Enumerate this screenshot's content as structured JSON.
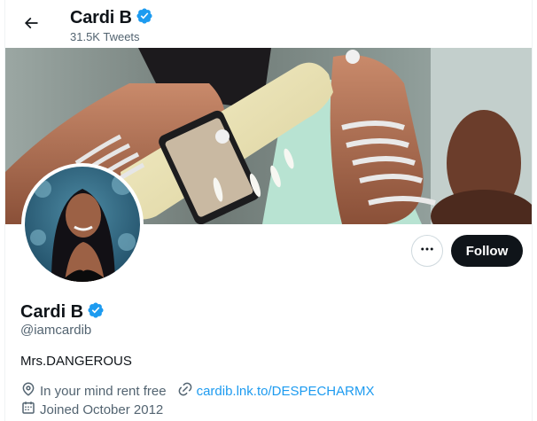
{
  "header": {
    "name": "Cardi B",
    "tweets": "31.5K Tweets"
  },
  "profile": {
    "display_name": "Cardi B",
    "handle": "@iamcardib",
    "bio": "Mrs.DANGEROUS",
    "location": "In your mind rent free",
    "website": "cardib.lnk.to/DESPECHARMX",
    "joined": "Joined October 2012"
  },
  "actions": {
    "follow_label": "Follow",
    "more_icon": "more-icon"
  },
  "icons": {
    "back": "arrow-left-icon",
    "verified": "verified-badge-icon",
    "location": "location-pin-icon",
    "link": "link-icon",
    "calendar": "calendar-icon"
  },
  "colors": {
    "accent": "#1d9bf0",
    "text": "#0f1419",
    "muted": "#536471",
    "follow_bg": "#0f1419"
  }
}
